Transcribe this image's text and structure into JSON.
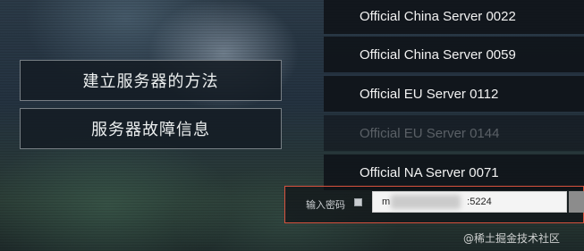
{
  "left_menu": {
    "how_to_build": "建立服务器的方法",
    "server_fault": "服务器故障信息"
  },
  "servers": [
    "Official China Server 0022",
    "Official China Server 0059",
    "Official EU Server 0112",
    "Official EU Server 0144",
    "Official NA Server 0071"
  ],
  "password": {
    "label": "输入密码",
    "value": "m:5224"
  },
  "watermark": "@稀土掘金技术社区"
}
